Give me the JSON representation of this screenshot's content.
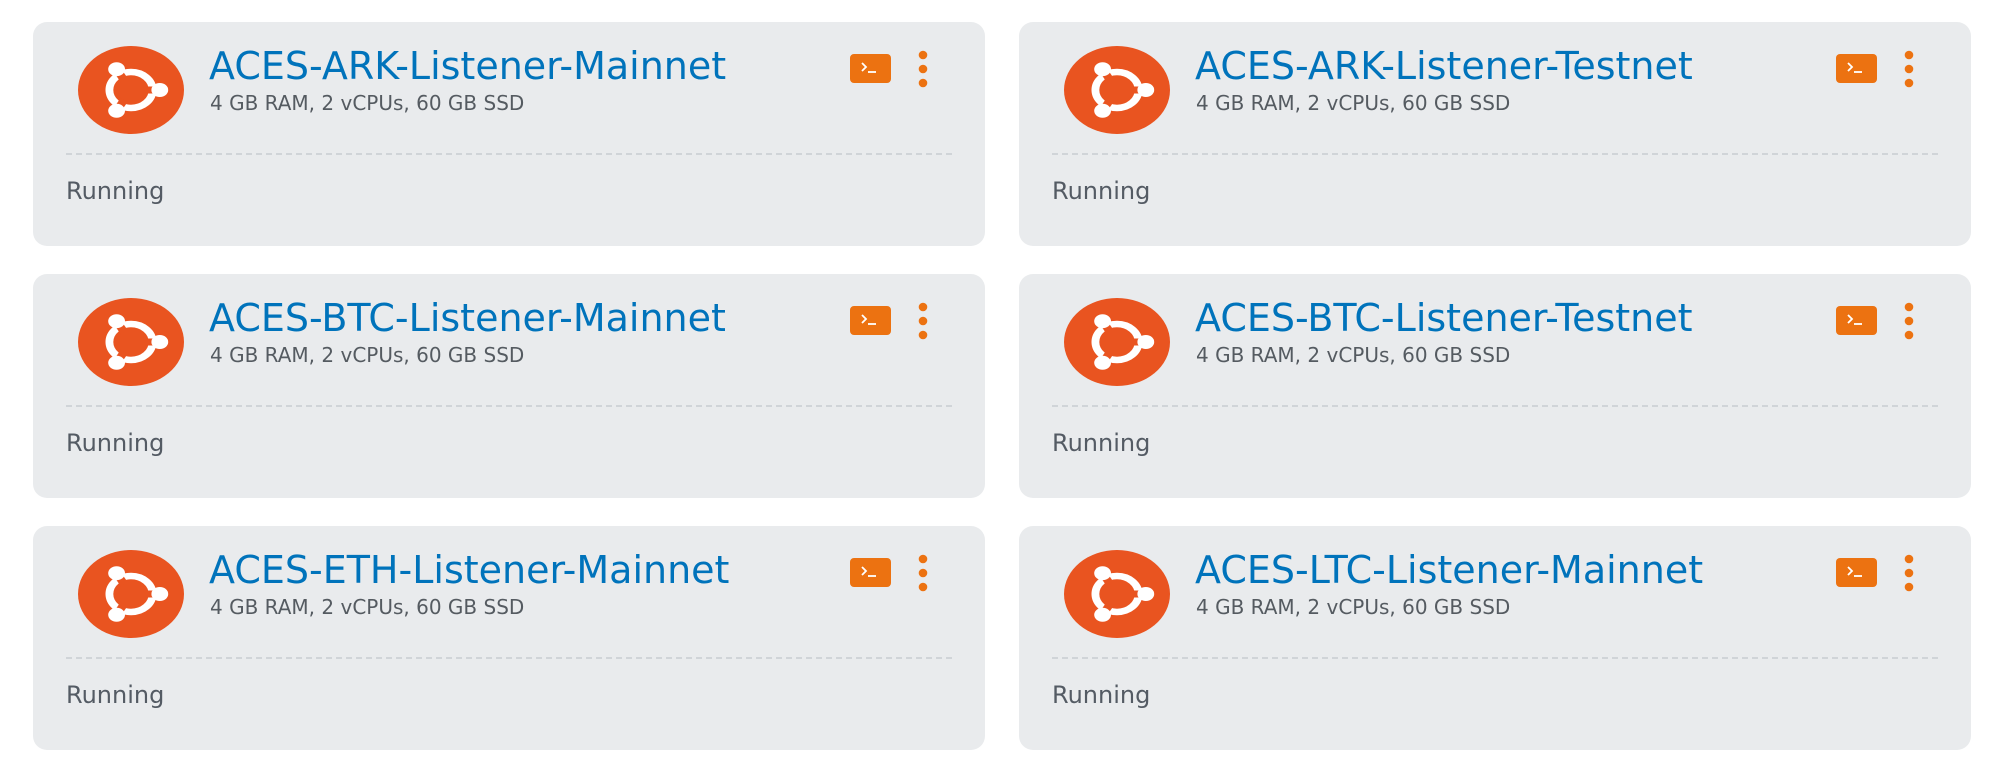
{
  "colors": {
    "card_background": "#e9ebed",
    "title_link": "#0073bb",
    "accent_orange": "#ec7211",
    "ubuntu_orange": "#e95420",
    "status_text": "#545b64"
  },
  "icons": {
    "os_logo": "ubuntu-logo-icon",
    "connect": "terminal-icon",
    "menu": "kebab-menu-icon"
  },
  "instances": [
    {
      "name": "ACES-ARK-Listener-Mainnet",
      "specs": "4 GB RAM, 2 vCPUs, 60 GB SSD",
      "status": "Running"
    },
    {
      "name": "ACES-ARK-Listener-Testnet",
      "specs": "4 GB RAM, 2 vCPUs, 60 GB SSD",
      "status": "Running"
    },
    {
      "name": "ACES-BTC-Listener-Mainnet",
      "specs": "4 GB RAM, 2 vCPUs, 60 GB SSD",
      "status": "Running"
    },
    {
      "name": "ACES-BTC-Listener-Testnet",
      "specs": "4 GB RAM, 2 vCPUs, 60 GB SSD",
      "status": "Running"
    },
    {
      "name": "ACES-ETH-Listener-Mainnet",
      "specs": "4 GB RAM, 2 vCPUs, 60 GB SSD",
      "status": "Running"
    },
    {
      "name": "ACES-LTC-Listener-Mainnet",
      "specs": "4 GB RAM, 2 vCPUs, 60 GB SSD",
      "status": "Running"
    }
  ]
}
